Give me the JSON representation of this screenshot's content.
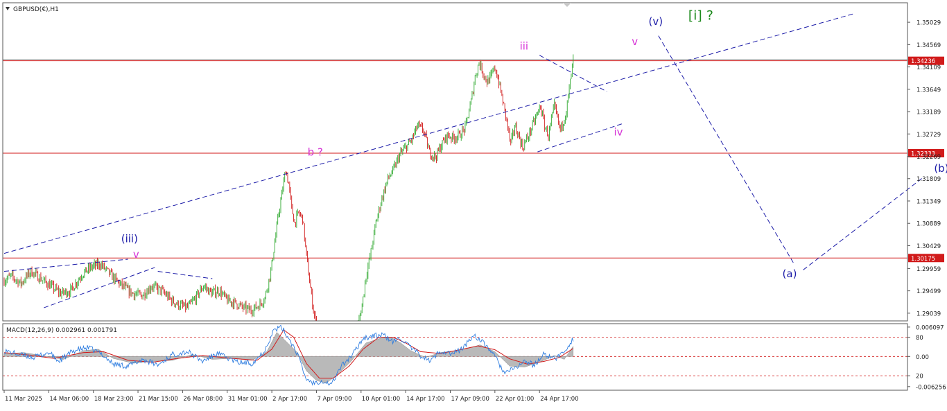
{
  "chart_data": {
    "type": "line",
    "title": "GBPUSD(€),H1",
    "symbol_icon": "triangle-down-icon",
    "price_axis": {
      "ylim": [
        1.2888,
        1.3543
      ],
      "ticks": [
        "1.35029",
        "1.34569",
        "1.34109",
        "1.33649",
        "1.33189",
        "1.32729",
        "1.32269",
        "1.31809",
        "1.31349",
        "1.30889",
        "1.30429",
        "1.29959",
        "1.29499",
        "1.29039"
      ],
      "tick_values": [
        1.35029,
        1.34569,
        1.34109,
        1.33649,
        1.33189,
        1.32729,
        1.32269,
        1.31809,
        1.31349,
        1.30889,
        1.30429,
        1.29959,
        1.29499,
        1.29039
      ]
    },
    "time_axis": {
      "labels": [
        "11 Mar 2025",
        "14 Mar 06:00",
        "18 Mar 23:00",
        "21 Mar 15:00",
        "26 Mar 08:00",
        "31 Mar 01:00",
        "2 Apr 17:00",
        "7 Apr 09:00",
        "10 Apr 01:00",
        "14 Apr 17:00",
        "17 Apr 09:00",
        "22 Apr 01:00",
        "24 Apr 17:00"
      ],
      "label_bar_index": [
        0,
        45,
        90,
        135,
        180,
        225,
        270,
        315,
        360,
        405,
        450,
        495,
        540
      ]
    },
    "bars_count": 575,
    "price_path": [
      [
        0,
        1.297
      ],
      [
        8,
        1.298
      ],
      [
        18,
        1.2965
      ],
      [
        28,
        1.299
      ],
      [
        38,
        1.2975
      ],
      [
        48,
        1.296
      ],
      [
        58,
        1.2945
      ],
      [
        68,
        1.295
      ],
      [
        80,
        1.2985
      ],
      [
        90,
        1.3
      ],
      [
        98,
        1.3005
      ],
      [
        105,
        1.299
      ],
      [
        112,
        1.2975
      ],
      [
        120,
        1.296
      ],
      [
        130,
        1.2945
      ],
      [
        140,
        1.294
      ],
      [
        150,
        1.296
      ],
      [
        160,
        1.295
      ],
      [
        170,
        1.293
      ],
      [
        178,
        1.292
      ],
      [
        186,
        1.2915
      ],
      [
        194,
        1.2935
      ],
      [
        202,
        1.296
      ],
      [
        210,
        1.2945
      ],
      [
        218,
        1.295
      ],
      [
        226,
        1.293
      ],
      [
        234,
        1.2925
      ],
      [
        242,
        1.2915
      ],
      [
        250,
        1.291
      ],
      [
        258,
        1.292
      ],
      [
        264,
        1.2935
      ],
      [
        270,
        1.299
      ],
      [
        274,
        1.305
      ],
      [
        278,
        1.311
      ],
      [
        282,
        1.316
      ],
      [
        285,
        1.32
      ],
      [
        288,
        1.317
      ],
      [
        291,
        1.312
      ],
      [
        294,
        1.309
      ],
      [
        298,
        1.311
      ],
      [
        302,
        1.31
      ],
      [
        305,
        1.304
      ],
      [
        309,
        1.297
      ],
      [
        313,
        1.291
      ],
      [
        318,
        1.286
      ],
      [
        323,
        1.284
      ],
      [
        330,
        1.2845
      ],
      [
        340,
        1.2855
      ],
      [
        350,
        1.287
      ],
      [
        358,
        1.288
      ],
      [
        362,
        1.292
      ],
      [
        366,
        1.298
      ],
      [
        371,
        1.303
      ],
      [
        376,
        1.309
      ],
      [
        382,
        1.314
      ],
      [
        388,
        1.318
      ],
      [
        394,
        1.32
      ],
      [
        400,
        1.323
      ],
      [
        406,
        1.3245
      ],
      [
        412,
        1.326
      ],
      [
        418,
        1.329
      ],
      [
        424,
        1.328
      ],
      [
        430,
        1.3235
      ],
      [
        436,
        1.3225
      ],
      [
        442,
        1.325
      ],
      [
        448,
        1.327
      ],
      [
        454,
        1.3265
      ],
      [
        460,
        1.327
      ],
      [
        466,
        1.3285
      ],
      [
        472,
        1.334
      ],
      [
        476,
        1.339
      ],
      [
        480,
        1.342
      ],
      [
        484,
        1.34
      ],
      [
        488,
        1.338
      ],
      [
        492,
        1.339
      ],
      [
        496,
        1.341
      ],
      [
        500,
        1.338
      ],
      [
        504,
        1.334
      ],
      [
        508,
        1.33
      ],
      [
        512,
        1.325
      ],
      [
        516,
        1.329
      ],
      [
        520,
        1.327
      ],
      [
        524,
        1.3245
      ],
      [
        530,
        1.327
      ],
      [
        536,
        1.33
      ],
      [
        542,
        1.333
      ],
      [
        546,
        1.329
      ],
      [
        550,
        1.327
      ],
      [
        556,
        1.333
      ],
      [
        562,
        1.328
      ],
      [
        568,
        1.332
      ],
      [
        572,
        1.338
      ],
      [
        575,
        1.3425
      ]
    ],
    "horizontal_levels": [
      {
        "price": 1.34236,
        "label": "1.34236"
      },
      {
        "price": 1.32333,
        "label": "1.32333"
      },
      {
        "price": 1.30175,
        "label": "1.30175"
      }
    ],
    "wave_labels": [
      {
        "text": "(iii)",
        "bar": 118,
        "price": 1.305,
        "color": "#1c1ca8"
      },
      {
        "text": "v",
        "bar": 130,
        "price": 1.3018,
        "color": "#d633d6"
      },
      {
        "text": "b ?",
        "bar": 306,
        "price": 1.3228,
        "color": "#d633d6"
      },
      {
        "text": "iii",
        "bar": 520,
        "price": 1.3447,
        "color": "#d633d6"
      },
      {
        "text": "v",
        "bar": 633,
        "price": 1.3456,
        "color": "#d633d6"
      },
      {
        "text": "iv",
        "bar": 615,
        "price": 1.327,
        "color": "#d633d6"
      },
      {
        "text": "(v)",
        "bar": 650,
        "price": 1.3497,
        "color": "#1c1ca8"
      },
      {
        "text": "[i] ?",
        "bar": 690,
        "price": 1.3508,
        "color": "#1e8a1e"
      },
      {
        "text": "(a)",
        "bar": 785,
        "price": 1.2978,
        "color": "#1c1ca8"
      },
      {
        "text": "(b)",
        "bar": 938,
        "price": 1.3195,
        "color": "#1c1ca8"
      }
    ],
    "trendlines": [
      {
        "from": [
          0,
          1.3027
        ],
        "to": [
          858,
          1.3521
        ]
      },
      {
        "from": [
          0,
          1.299
        ],
        "to": [
          125,
          1.3015
        ]
      },
      {
        "from": [
          40,
          1.2915
        ],
        "to": [
          152,
          1.2998
        ]
      },
      {
        "from": [
          155,
          1.299
        ],
        "to": [
          210,
          1.2975
        ]
      },
      {
        "from": [
          540,
          1.3435
        ],
        "to": [
          608,
          1.336
        ]
      },
      {
        "from": [
          538,
          1.3236
        ],
        "to": [
          625,
          1.3295
        ]
      },
      {
        "from": [
          660,
          1.3475
        ],
        "to": [
          796,
          1.3008
        ]
      },
      {
        "from": [
          806,
          1.2993
        ],
        "to": [
          928,
          1.3185
        ]
      }
    ],
    "macd": {
      "title": "MACD(12,26,9) 0.002961 0.001791",
      "ylim": [
        -0.007,
        0.0068
      ],
      "ticks": [
        "0.006097",
        "80",
        "0.00",
        "20",
        "-0.006256"
      ],
      "tick_values": [
        0.006097,
        0.004,
        0.0,
        -0.004,
        -0.006256
      ],
      "levels": [
        0.004,
        0.0,
        -0.004
      ],
      "histogram": [
        [
          0,
          0.0006
        ],
        [
          20,
          0.0008
        ],
        [
          40,
          0.0001
        ],
        [
          60,
          -0.0006
        ],
        [
          80,
          0.0012
        ],
        [
          95,
          0.0015
        ],
        [
          110,
          -0.0004
        ],
        [
          130,
          -0.0014
        ],
        [
          150,
          -0.001
        ],
        [
          170,
          -0.0008
        ],
        [
          190,
          0.0004
        ],
        [
          210,
          -0.0006
        ],
        [
          230,
          -0.0004
        ],
        [
          250,
          -0.0008
        ],
        [
          265,
          0.001
        ],
        [
          275,
          0.005
        ],
        [
          285,
          0.003
        ],
        [
          295,
          0.001
        ],
        [
          305,
          -0.003
        ],
        [
          315,
          -0.005
        ],
        [
          325,
          -0.0055
        ],
        [
          335,
          -0.004
        ],
        [
          350,
          -0.001
        ],
        [
          365,
          0.0028
        ],
        [
          380,
          0.0038
        ],
        [
          390,
          0.004
        ],
        [
          400,
          0.0028
        ],
        [
          410,
          0.0012
        ],
        [
          425,
          -0.0002
        ],
        [
          440,
          0.0008
        ],
        [
          455,
          0.0012
        ],
        [
          470,
          0.0018
        ],
        [
          480,
          0.0024
        ],
        [
          495,
          0.001
        ],
        [
          510,
          -0.002
        ],
        [
          525,
          -0.0022
        ],
        [
          540,
          -0.0012
        ],
        [
          555,
          0.0002
        ],
        [
          565,
          -0.0006
        ],
        [
          575,
          0.0024
        ]
      ],
      "signal_path": [
        [
          0,
          0.0008
        ],
        [
          25,
          0.0003
        ],
        [
          50,
          -0.0004
        ],
        [
          80,
          0.0008
        ],
        [
          100,
          0.001
        ],
        [
          125,
          -0.0008
        ],
        [
          150,
          -0.0012
        ],
        [
          175,
          -0.0004
        ],
        [
          200,
          0.0002
        ],
        [
          230,
          -0.0004
        ],
        [
          255,
          -0.0008
        ],
        [
          270,
          0.0015
        ],
        [
          282,
          0.0055
        ],
        [
          292,
          0.004
        ],
        [
          305,
          -0.0015
        ],
        [
          318,
          -0.0045
        ],
        [
          332,
          -0.0045
        ],
        [
          348,
          -0.002
        ],
        [
          362,
          0.0015
        ],
        [
          378,
          0.004
        ],
        [
          392,
          0.004
        ],
        [
          405,
          0.0028
        ],
        [
          420,
          0.001
        ],
        [
          440,
          0.0006
        ],
        [
          460,
          0.0014
        ],
        [
          478,
          0.0022
        ],
        [
          495,
          0.0014
        ],
        [
          510,
          -0.0005
        ],
        [
          528,
          -0.0016
        ],
        [
          545,
          -0.001
        ],
        [
          560,
          -0.0002
        ],
        [
          575,
          0.0018
        ]
      ],
      "main_path": [
        [
          0,
          0.0012
        ],
        [
          15,
          0.0004
        ],
        [
          30,
          -0.0002
        ],
        [
          45,
          0.0008
        ],
        [
          55,
          -0.001
        ],
        [
          70,
          0.0012
        ],
        [
          85,
          0.0018
        ],
        [
          98,
          0.0006
        ],
        [
          110,
          -0.0016
        ],
        [
          125,
          -0.002
        ],
        [
          140,
          -0.0006
        ],
        [
          155,
          -0.0018
        ],
        [
          170,
          0.0004
        ],
        [
          185,
          0.001
        ],
        [
          200,
          -0.001
        ],
        [
          215,
          0.0006
        ],
        [
          235,
          -0.0012
        ],
        [
          250,
          -0.0014
        ],
        [
          262,
          0.001
        ],
        [
          272,
          0.0055
        ],
        [
          280,
          0.006
        ],
        [
          288,
          0.0035
        ],
        [
          296,
          0.0005
        ],
        [
          304,
          -0.0045
        ],
        [
          312,
          -0.0055
        ],
        [
          320,
          -0.005
        ],
        [
          330,
          -0.0058
        ],
        [
          340,
          -0.002
        ],
        [
          352,
          0.0005
        ],
        [
          362,
          0.0038
        ],
        [
          372,
          0.0042
        ],
        [
          382,
          0.0045
        ],
        [
          392,
          0.003
        ],
        [
          400,
          0.0038
        ],
        [
          410,
          0.0018
        ],
        [
          420,
          0.0002
        ],
        [
          430,
          -0.001
        ],
        [
          440,
          0.0012
        ],
        [
          452,
          0.0005
        ],
        [
          462,
          0.0016
        ],
        [
          474,
          0.0045
        ],
        [
          482,
          0.003
        ],
        [
          492,
          0.001
        ],
        [
          505,
          -0.0035
        ],
        [
          515,
          -0.0025
        ],
        [
          525,
          -0.001
        ],
        [
          535,
          -0.0018
        ],
        [
          545,
          0.0006
        ],
        [
          555,
          -0.0006
        ],
        [
          565,
          0.001
        ],
        [
          575,
          0.004
        ]
      ]
    },
    "colors": {
      "bull": "#2ea82e",
      "bear": "#d11a1a",
      "trendline": "#1c1ca8",
      "level_line": "#d11a1a",
      "macd_main": "#2e7de0",
      "macd_signal": "#d11a1a",
      "histogram": "#b9b9b9",
      "frame": "#555555"
    }
  }
}
